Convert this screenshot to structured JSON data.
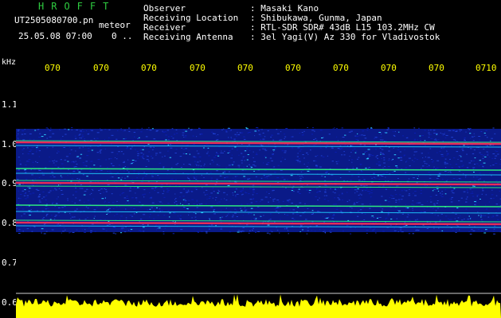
{
  "header": {
    "app_title": "HROFFT",
    "file_name": "UT2505080700.pn",
    "meteor_label": "meteor",
    "date_time": "25.05.08 07:00",
    "counter": "0 .."
  },
  "info": {
    "observer_label": "Observer",
    "observer_value": ": Masaki Kano",
    "location_label": "Receiving Location",
    "location_value": ": Shibukawa, Gunma, Japan",
    "receiver_label": "Receiver",
    "receiver_value": ": RTL-SDR SDR# 43dB L15 103.2MHz CW",
    "antenna_label": "Receiving Antenna",
    "antenna_value": ": 3el Yagi(V) Az 330 for Vladivostok"
  },
  "axes": {
    "unit_label": "kHz",
    "time_ticks": [
      "070",
      "070",
      "070",
      "070",
      "070",
      "070",
      "070",
      "070",
      "070",
      "0710"
    ],
    "freq_ticks": [
      "1.1",
      "1.0",
      "0.9",
      "0.8",
      "0.7",
      "0.6"
    ]
  },
  "colors": {
    "background": "#000000",
    "noise": "#1f3fd0",
    "line_strong": "#ff2d55",
    "line_medium": "#30ff80",
    "signal_bar": "#ffff00"
  }
}
